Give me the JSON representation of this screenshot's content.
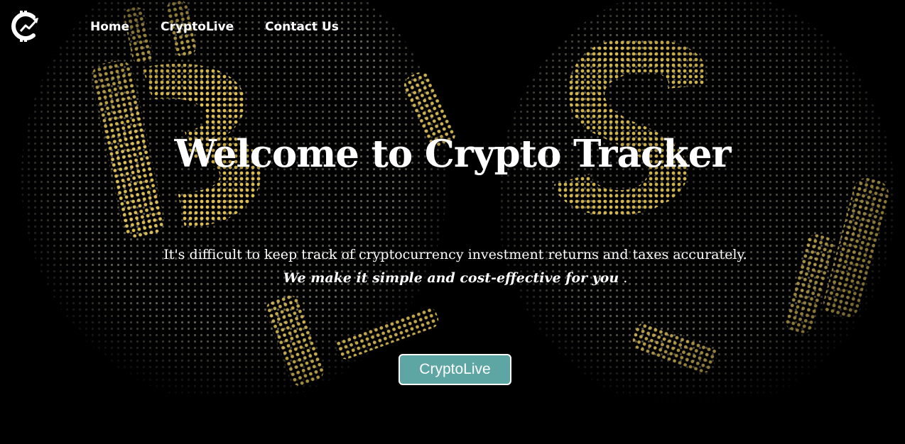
{
  "nav": {
    "logo_icon": "crypto-growth-logo-icon",
    "links": [
      {
        "label": "Home"
      },
      {
        "label": "CryptoLive"
      },
      {
        "label": "Contact Us"
      }
    ]
  },
  "hero": {
    "title": "Welcome to Crypto Tracker",
    "description": "It's difficult to keep track of cryptocurrency investment returns and taxes accurately.",
    "tagline": "We make it simple and cost-effective for you",
    "tagline_suffix": " .",
    "cta_label": "CryptoLive",
    "background_image": "gold dotted bitcoin and dollar symbols"
  },
  "colors": {
    "background": "#000000",
    "text": "#ffffff",
    "cta_background": "#5ea6a4",
    "accent_gold": "#d9b43a"
  }
}
